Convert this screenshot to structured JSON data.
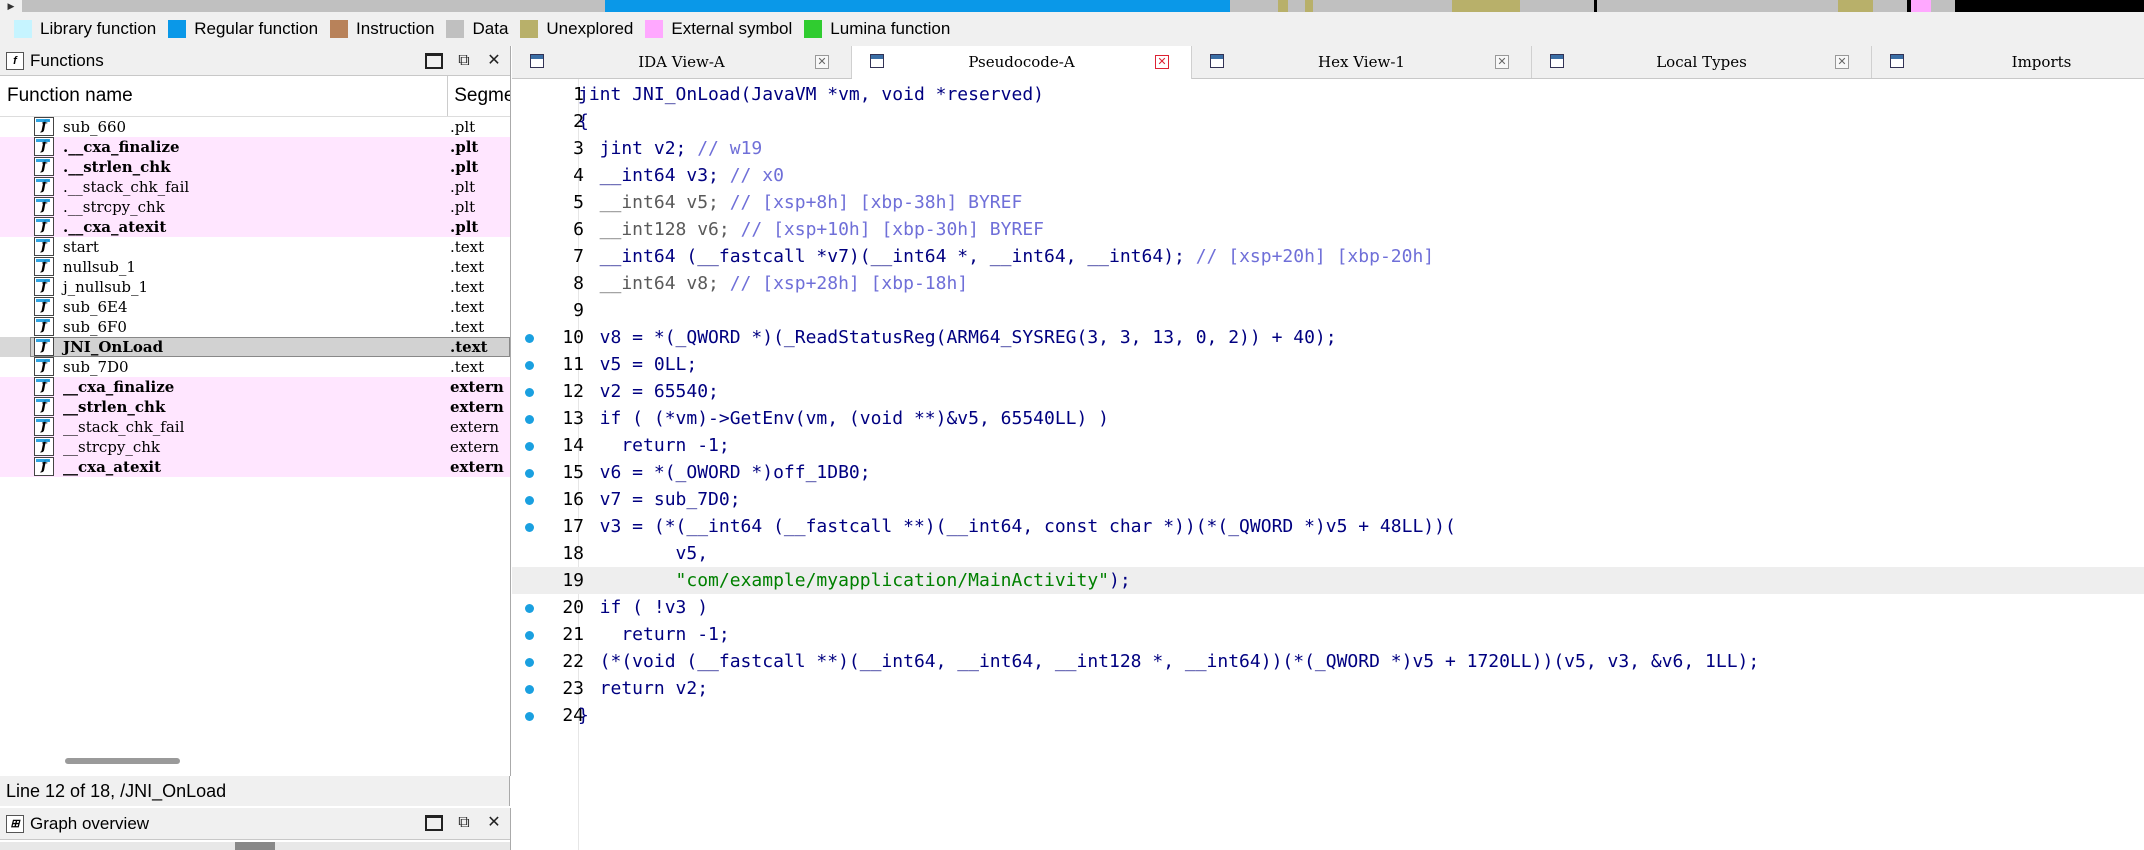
{
  "legend": [
    {
      "label": "Library function",
      "color": "#c6f4ff"
    },
    {
      "label": "Regular function",
      "color": "#0a98e8"
    },
    {
      "label": "Instruction",
      "color": "#b8825a"
    },
    {
      "label": "Data",
      "color": "#c0c0c0"
    },
    {
      "label": "Unexplored",
      "color": "#b8b06a"
    },
    {
      "label": "External symbol",
      "color": "#ffa8ff"
    },
    {
      "label": "Lumina function",
      "color": "#30cc30"
    }
  ],
  "functions_panel": {
    "title": "Functions",
    "columns": {
      "name": "Function name",
      "segment": "Segme"
    },
    "rows": [
      {
        "name": "sub_660",
        "segment": ".plt",
        "style": "normal"
      },
      {
        "name": ".__cxa_finalize",
        "segment": ".plt",
        "style": "bold-ext"
      },
      {
        "name": ".__strlen_chk",
        "segment": ".plt",
        "style": "bold-ext"
      },
      {
        "name": ".__stack_chk_fail",
        "segment": ".plt",
        "style": "ext"
      },
      {
        "name": ".__strcpy_chk",
        "segment": ".plt",
        "style": "ext"
      },
      {
        "name": ".__cxa_atexit",
        "segment": ".plt",
        "style": "bold-ext"
      },
      {
        "name": "start",
        "segment": ".text",
        "style": "normal"
      },
      {
        "name": "nullsub_1",
        "segment": ".text",
        "style": "normal"
      },
      {
        "name": "j_nullsub_1",
        "segment": ".text",
        "style": "normal"
      },
      {
        "name": "sub_6E4",
        "segment": ".text",
        "style": "normal"
      },
      {
        "name": "sub_6F0",
        "segment": ".text",
        "style": "normal"
      },
      {
        "name": "JNI_OnLoad",
        "segment": ".text",
        "style": "selected"
      },
      {
        "name": "sub_7D0",
        "segment": ".text",
        "style": "normal"
      },
      {
        "name": "__cxa_finalize",
        "segment": "extern",
        "style": "bold-ext"
      },
      {
        "name": "__strlen_chk",
        "segment": "extern",
        "style": "bold-ext"
      },
      {
        "name": "__stack_chk_fail",
        "segment": "extern",
        "style": "ext"
      },
      {
        "name": "__strcpy_chk",
        "segment": "extern",
        "style": "ext"
      },
      {
        "name": "__cxa_atexit",
        "segment": "extern",
        "style": "bold-ext"
      }
    ]
  },
  "status_line": "Line 12 of 18, /JNI_OnLoad",
  "graph_overview": {
    "title": "Graph overview"
  },
  "tabs": [
    {
      "label": "IDA View-A",
      "active": false
    },
    {
      "label": "Pseudocode-A",
      "active": true
    },
    {
      "label": "Hex View-1",
      "active": false
    },
    {
      "label": "Local Types",
      "active": false
    },
    {
      "label": "Imports",
      "active": false
    }
  ],
  "code": [
    {
      "n": "1",
      "bp": false,
      "parts": [
        [
          "",
          "jint JNI_OnLoad(JavaVM *vm, void *reserved)"
        ]
      ]
    },
    {
      "n": "2",
      "bp": false,
      "parts": [
        [
          "",
          "{"
        ]
      ]
    },
    {
      "n": "3",
      "bp": false,
      "parts": [
        [
          "",
          "  jint v2; "
        ],
        [
          "cmt",
          "// w19"
        ]
      ]
    },
    {
      "n": "4",
      "bp": false,
      "parts": [
        [
          "",
          "  __int64 v3; "
        ],
        [
          "cmt",
          "// x0"
        ]
      ]
    },
    {
      "n": "5",
      "bp": false,
      "parts": [
        [
          "gry",
          "  __int64 v5; "
        ],
        [
          "cmt",
          "// [xsp+8h] [xbp-38h] BYREF"
        ]
      ]
    },
    {
      "n": "6",
      "bp": false,
      "parts": [
        [
          "gry",
          "  __int128 v6; "
        ],
        [
          "cmt",
          "// [xsp+10h] [xbp-30h] BYREF"
        ]
      ]
    },
    {
      "n": "7",
      "bp": false,
      "parts": [
        [
          "",
          "  __int64 (__fastcall *v7)(__int64 *, __int64, __int64); "
        ],
        [
          "cmt",
          "// [xsp+20h] [xbp-20h]"
        ]
      ]
    },
    {
      "n": "8",
      "bp": false,
      "parts": [
        [
          "gry",
          "  __int64 v8; "
        ],
        [
          "cmt",
          "// [xsp+28h] [xbp-18h]"
        ]
      ]
    },
    {
      "n": "9",
      "bp": false,
      "parts": [
        [
          "",
          ""
        ]
      ]
    },
    {
      "n": "10",
      "bp": true,
      "parts": [
        [
          "",
          "  v8 = *(_QWORD *)(_ReadStatusReg(ARM64_SYSREG(3, 3, 13, 0, 2)) + 40);"
        ]
      ]
    },
    {
      "n": "11",
      "bp": true,
      "parts": [
        [
          "",
          "  v5 = 0LL;"
        ]
      ]
    },
    {
      "n": "12",
      "bp": true,
      "parts": [
        [
          "",
          "  v2 = 65540;"
        ]
      ]
    },
    {
      "n": "13",
      "bp": true,
      "parts": [
        [
          "",
          "  if ( (*vm)->GetEnv(vm, (void **)&v5, 65540LL) )"
        ]
      ]
    },
    {
      "n": "14",
      "bp": true,
      "parts": [
        [
          "",
          "    return -1;"
        ]
      ]
    },
    {
      "n": "15",
      "bp": true,
      "parts": [
        [
          "",
          "  v6 = *(_OWORD *)off_1DB0;"
        ]
      ]
    },
    {
      "n": "16",
      "bp": true,
      "parts": [
        [
          "",
          "  v7 = sub_7D0;"
        ]
      ]
    },
    {
      "n": "17",
      "bp": true,
      "parts": [
        [
          "",
          "  v3 = (*(__int64 (__fastcall **)(__int64, const char *))(*(_QWORD *)v5 + 48LL))("
        ]
      ]
    },
    {
      "n": "18",
      "bp": false,
      "parts": [
        [
          "",
          "         v5,"
        ]
      ]
    },
    {
      "n": "19",
      "bp": false,
      "current": true,
      "parts": [
        [
          "",
          "         "
        ],
        [
          "str",
          "\"com/example/myapplication/MainActivity\""
        ],
        [
          "",
          ");"
        ]
      ]
    },
    {
      "n": "20",
      "bp": true,
      "parts": [
        [
          "",
          "  if ( !v3 )"
        ]
      ]
    },
    {
      "n": "21",
      "bp": true,
      "parts": [
        [
          "",
          "    return -1;"
        ]
      ]
    },
    {
      "n": "22",
      "bp": true,
      "parts": [
        [
          "",
          "  (*(void (__fastcall **)(__int64, __int64, __int128 *, __int64))(*(_QWORD *)v5 + 1720LL))(v5, v3, &v6, 1LL);"
        ]
      ]
    },
    {
      "n": "23",
      "bp": true,
      "parts": [
        [
          "",
          "  return v2;"
        ]
      ]
    },
    {
      "n": "24",
      "bp": true,
      "parts": [
        [
          "",
          "}"
        ]
      ]
    }
  ]
}
